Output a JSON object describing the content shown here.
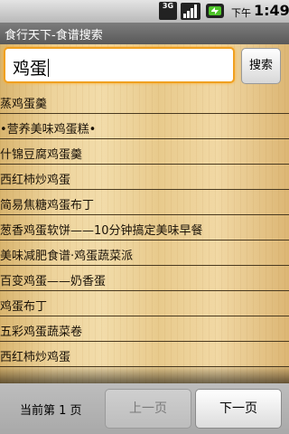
{
  "status_bar": {
    "network": "3G",
    "ampm": "下午",
    "time": "1:49"
  },
  "title_bar": {
    "title": "食行天下-食谱搜索"
  },
  "search": {
    "value": "鸡蛋",
    "button_label": "搜索"
  },
  "results": [
    "蒸鸡蛋羹",
    "•营养美味鸡蛋糕•",
    "什锦豆腐鸡蛋羹",
    "西红柿炒鸡蛋",
    "简易焦糖鸡蛋布丁",
    "葱香鸡蛋软饼——10分钟搞定美味早餐",
    "美味减肥食谱·鸡蛋蔬菜派",
    "百变鸡蛋——奶香蛋",
    "鸡蛋布丁",
    "五彩鸡蛋蔬菜卷",
    "西红柿炒鸡蛋"
  ],
  "pagination": {
    "current_label": "当前第 1 页",
    "prev_label": "上一页",
    "next_label": "下一页"
  },
  "colors": {
    "status_bar": "#c8c8c8",
    "title_bar": "#6a6a6a",
    "focus_border": "#f0a020",
    "wood": "#ecd19a"
  },
  "icons": {
    "network": "3g-icon",
    "signal": "signal-icon",
    "battery": "battery-icon"
  }
}
